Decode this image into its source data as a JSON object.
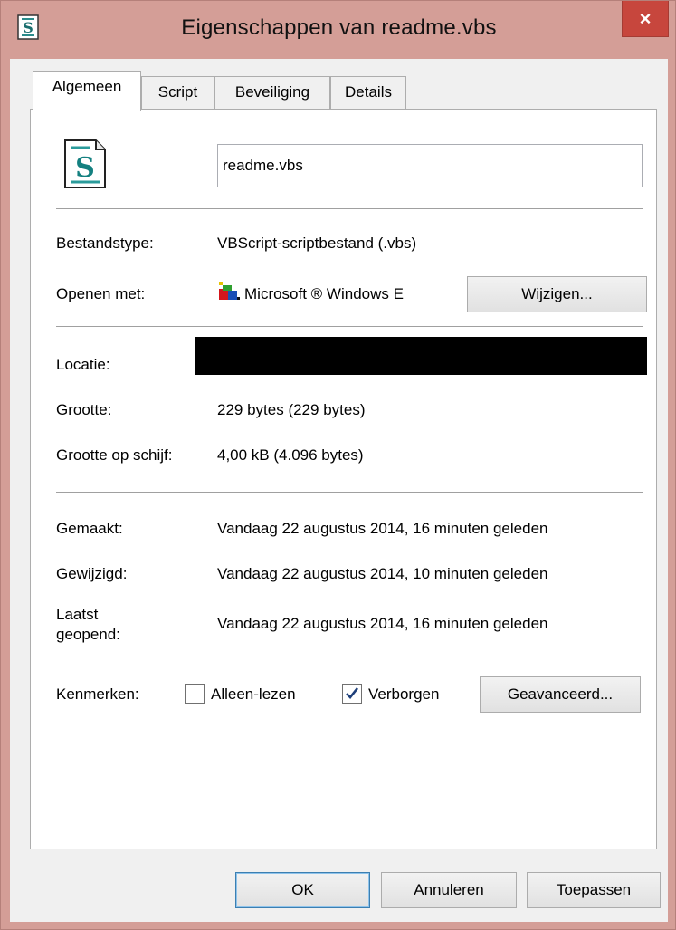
{
  "window": {
    "title": "Eigenschappen van readme.vbs",
    "close_label": "×",
    "title_icon": "vbs-script-icon"
  },
  "tabs": [
    {
      "label": "Algemeen",
      "active": true
    },
    {
      "label": "Script",
      "active": false
    },
    {
      "label": "Beveiliging",
      "active": false
    },
    {
      "label": "Details",
      "active": false
    }
  ],
  "general": {
    "file_icon": "vbs-script-icon",
    "filename": "readme.vbs",
    "type_label": "Bestandstype:",
    "type_value": "VBScript-scriptbestand (.vbs)",
    "opens_label": "Openen met:",
    "opens_icon": "windows-script-host-icon",
    "opens_value": "Microsoft ® Windows E",
    "change_button": "Wijzigen...",
    "location_label": "Locatie:",
    "size_label": "Grootte:",
    "size_value": "229 bytes (229 bytes)",
    "disk_size_label": "Grootte op schijf:",
    "disk_size_value": "4,00 kB (4.096 bytes)",
    "created_label": "Gemaakt:",
    "created_value": "Vandaag 22 augustus 2014, 16 minuten geleden",
    "modified_label": "Gewijzigd:",
    "modified_value": "Vandaag 22 augustus 2014, 10 minuten geleden",
    "accessed_label_1": "Laatst",
    "accessed_label_2": "geopend:",
    "accessed_value": "Vandaag 22 augustus 2014, 16 minuten geleden",
    "attributes_label": "Kenmerken:",
    "readonly_label": "Alleen-lezen",
    "readonly_checked": false,
    "hidden_label": "Verborgen",
    "hidden_checked": true,
    "advanced_button": "Geavanceerd..."
  },
  "footer": {
    "ok": "OK",
    "cancel": "Annuleren",
    "apply": "Toepassen"
  },
  "colors": {
    "title_bar": "#d49e97",
    "close_button": "#c7463d",
    "accent_border": "#3c7fb1",
    "checkmark": "#1e3f7a"
  }
}
